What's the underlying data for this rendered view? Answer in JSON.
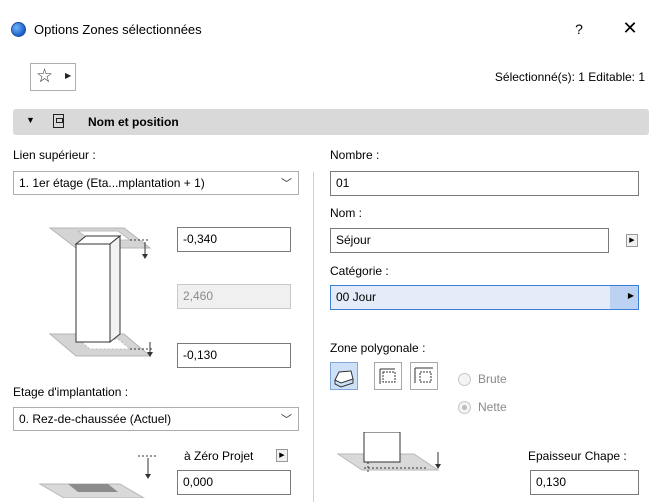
{
  "window": {
    "title": "Options Zones sélectionnées",
    "help": "?",
    "close": "✕"
  },
  "toolbar": {
    "favorites_star": "☆",
    "favorites_arrow": "▶",
    "selection_info": "Sélectionné(s): 1 Editable: 1"
  },
  "panel": {
    "title": "Nom et position"
  },
  "left": {
    "top_link_label": "Lien supérieur :",
    "top_link_value": "1. 1er étage (Eta...mplantation + 1)",
    "top_offset": "-0,340",
    "height": "2,460",
    "bottom_offset": "-0,130",
    "home_story_label": "Etage d'implantation :",
    "home_story_value": "0. Rez-de-chaussée (Actuel)",
    "project_zero_label": "à Zéro Projet",
    "project_zero_value": "0,000"
  },
  "right": {
    "number_label": "Nombre :",
    "number_value": "01",
    "name_label": "Nom :",
    "name_value": "Séjour",
    "category_label": "Catégorie :",
    "category_value": "00  Jour",
    "polygon_label": "Zone polygonale :",
    "gross_label": "Brute",
    "net_label": "Nette",
    "topping_label": "Epaisseur Chape :",
    "topping_value": "0,130"
  }
}
